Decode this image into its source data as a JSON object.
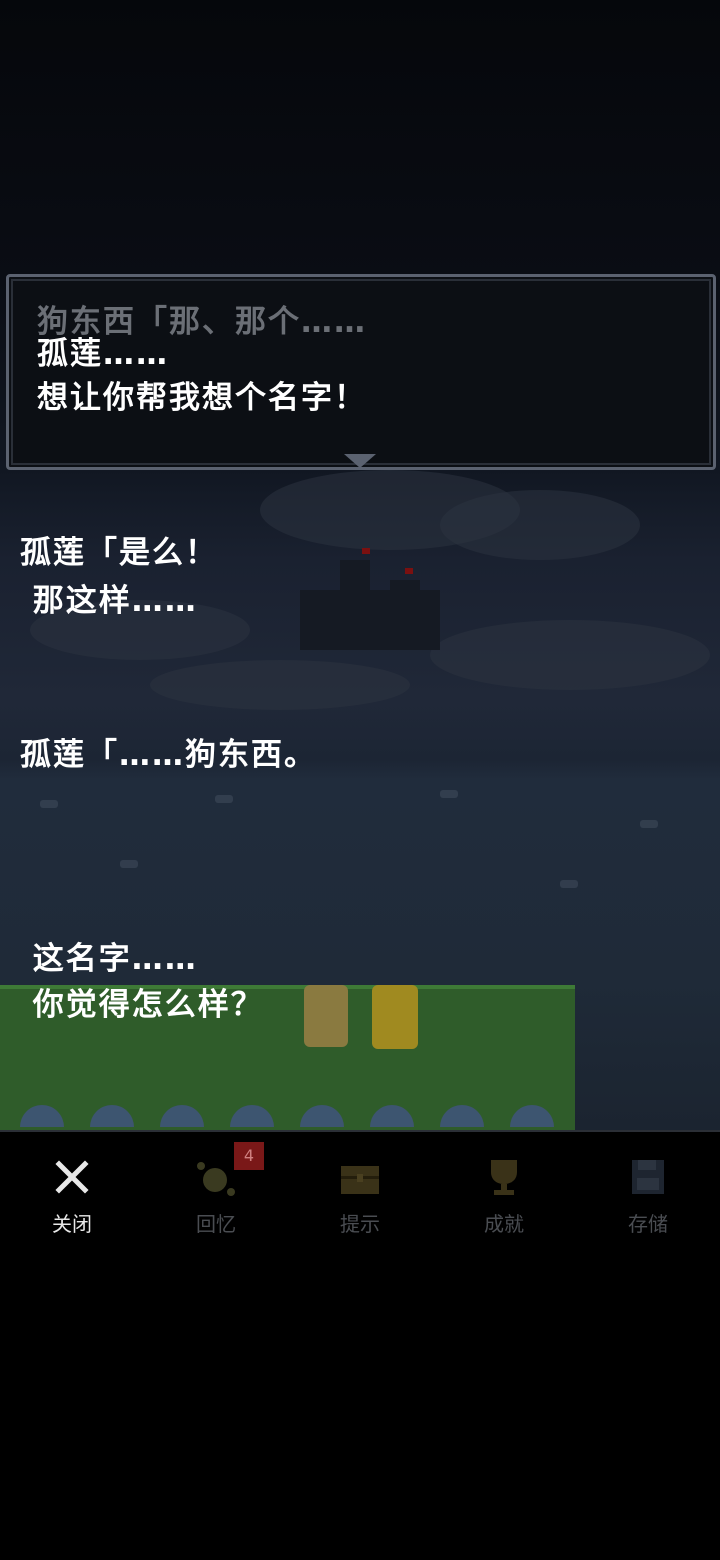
{
  "dialog_box": {
    "previous_line": "狗东西「那、那个……",
    "lines": [
      "孤莲……",
      "想让你帮我想个名字！"
    ]
  },
  "story_text": [
    {
      "line1": "孤莲「是么！",
      "line2": " 那这样……"
    },
    {
      "line1": "孤莲「……狗东西。"
    },
    {
      "line1": " 这名字……",
      "line2": " 你觉得怎么样？"
    }
  ],
  "bottom_tabs": [
    {
      "label": "关闭",
      "icon": "close-icon",
      "active": true
    },
    {
      "label": "回忆",
      "icon": "memory-icon",
      "badge": "4"
    },
    {
      "label": "提示",
      "icon": "treasure-chest-icon"
    },
    {
      "label": "成就",
      "icon": "trophy-icon"
    },
    {
      "label": "存储",
      "icon": "floppy-disk-icon"
    }
  ],
  "colors": {
    "text": "#ffffff",
    "dim_text": "#6b6f76",
    "badge": "#7a1818",
    "grass": "#2f5c2a"
  }
}
